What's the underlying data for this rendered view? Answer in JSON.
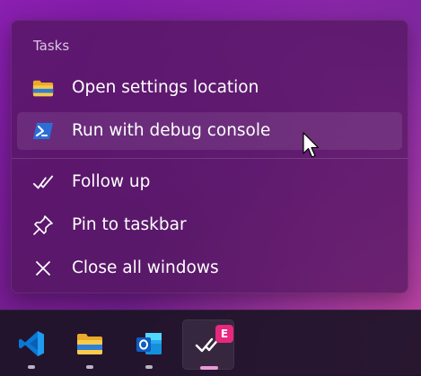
{
  "jump_list": {
    "section_header": "Tasks",
    "items": [
      {
        "label": "Open settings location",
        "icon": "folder-icon",
        "hovered": false
      },
      {
        "label": "Run with debug console",
        "icon": "powershell-icon",
        "hovered": true
      },
      {
        "label": "Follow up",
        "icon": "checkmark-icon",
        "hovered": false
      },
      {
        "label": "Pin to taskbar",
        "icon": "pin-icon",
        "hovered": false
      },
      {
        "label": "Close all windows",
        "icon": "close-icon",
        "hovered": false
      }
    ]
  },
  "taskbar": {
    "apps": [
      {
        "icon": "vscode-icon",
        "running": true,
        "active": false
      },
      {
        "icon": "file-explorer-icon",
        "running": true,
        "active": false
      },
      {
        "icon": "outlook-icon",
        "running": true,
        "active": false
      },
      {
        "icon": "espanso-icon",
        "running": true,
        "active": true,
        "badge": "E"
      }
    ]
  },
  "colors": {
    "menu_bg": "#50165c",
    "taskbar_bg": "#1c1426",
    "badge": "#e8287e",
    "active_indicator": "#e79ad6",
    "vscode_blue": "#0a78d4",
    "outlook_blue": "#0f5cc2",
    "folder_yellow": "#f5c542"
  }
}
